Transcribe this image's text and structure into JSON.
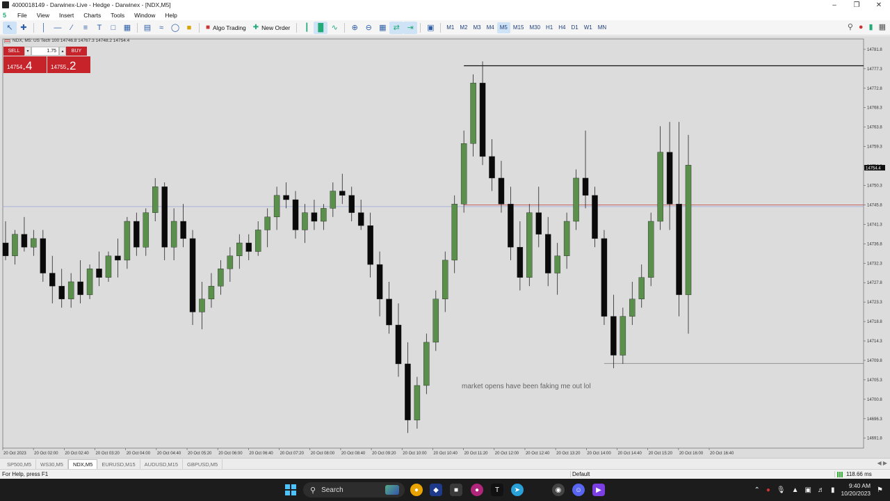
{
  "window": {
    "title": "4000018149 - Darwinex-Live - Hedge - Darwinex - [NDX,M5]"
  },
  "menu": [
    "File",
    "View",
    "Insert",
    "Charts",
    "Tools",
    "Window",
    "Help"
  ],
  "toolbar": {
    "algo_trading": "Algo Trading",
    "new_order": "New Order",
    "timeframes": [
      "M1",
      "M2",
      "M3",
      "M4",
      "M5",
      "M15",
      "M30",
      "H1",
      "H4",
      "D1",
      "W1",
      "MN"
    ],
    "active_timeframe": "M5"
  },
  "chart": {
    "symbol_line": "NDX, M5: US Tech 100  14746.8 14767.3 14748.2 14754.4",
    "trade_panel": {
      "sell_label": "SELL",
      "buy_label": "BUY",
      "lot": "1.75",
      "sell_price_small": "14754",
      "sell_price_big": ".4",
      "buy_price_small": "14755",
      "buy_price_big": ".2"
    },
    "annotation": "market opens have been faking me out lol",
    "current_price_label": "14754.4",
    "colors": {
      "bull": "#5b8f4c",
      "bear": "#0a0a0a",
      "bid_line": "#c0504d",
      "ask_line": "#9aa3d8",
      "background": "#dcdcdc"
    }
  },
  "chart_data": {
    "type": "candlestick",
    "x_tick_labels": [
      "20 Oct 2023",
      "20 Oct 02:00",
      "20 Oct 02:40",
      "20 Oct 03:20",
      "20 Oct 04:00",
      "20 Oct 04:40",
      "20 Oct 05:20",
      "20 Oct 06:00",
      "20 Oct 06:40",
      "20 Oct 07:20",
      "20 Oct 08:00",
      "20 Oct 08:40",
      "20 Oct 09:20",
      "20 Oct 10:00",
      "20 Oct 10:40",
      "20 Oct 11:20",
      "20 Oct 12:00",
      "20 Oct 12:40",
      "20 Oct 13:20",
      "20 Oct 14:00",
      "20 Oct 14:40",
      "20 Oct 15:20",
      "20 Oct 16:00",
      "20 Oct 16:40"
    ],
    "y_tick_labels": [
      "14781.8",
      "14777.3",
      "14772.8",
      "14768.3",
      "14763.8",
      "14759.3",
      "14754.8",
      "14750.3",
      "14745.8",
      "14741.3",
      "14736.8",
      "14732.3",
      "14727.8",
      "14723.3",
      "14718.8",
      "14714.3",
      "14709.8",
      "14705.3",
      "14700.8",
      "14696.3",
      "14691.8"
    ],
    "ylim": [
      14689.5,
      14784.2
    ],
    "bid": 14745.8,
    "ask": 14745.4,
    "last": 14754.4,
    "horizontal_levels": [
      14778.0,
      14709.1
    ],
    "candles_ohlc": [
      [
        14737,
        14742,
        14733,
        14734
      ],
      [
        14734,
        14740,
        14732,
        14739
      ],
      [
        14739,
        14743,
        14735,
        14736
      ],
      [
        14736,
        14740,
        14734,
        14738
      ],
      [
        14738,
        14740,
        14728,
        14730
      ],
      [
        14730,
        14734,
        14723,
        14727
      ],
      [
        14727,
        14731,
        14722,
        14724
      ],
      [
        14724,
        14730,
        14722,
        14728
      ],
      [
        14728,
        14733,
        14723,
        14725
      ],
      [
        14725,
        14732,
        14724,
        14731
      ],
      [
        14731,
        14735,
        14727,
        14729
      ],
      [
        14729,
        14735,
        14728,
        14734
      ],
      [
        14734,
        14738,
        14729,
        14733
      ],
      [
        14733,
        14743,
        14731,
        14742
      ],
      [
        14742,
        14744,
        14734,
        14736
      ],
      [
        14736,
        14745,
        14734,
        14744
      ],
      [
        14744,
        14752,
        14742,
        14750
      ],
      [
        14750,
        14751,
        14733,
        14736
      ],
      [
        14736,
        14745,
        14733,
        14742
      ],
      [
        14742,
        14746,
        14736,
        14738
      ],
      [
        14738,
        14740,
        14718,
        14721
      ],
      [
        14721,
        14728,
        14717,
        14724
      ],
      [
        14724,
        14730,
        14722,
        14727
      ],
      [
        14727,
        14733,
        14725,
        14731
      ],
      [
        14731,
        14736,
        14728,
        14734
      ],
      [
        14734,
        14739,
        14731,
        14737
      ],
      [
        14737,
        14739,
        14733,
        14735
      ],
      [
        14735,
        14742,
        14734,
        14740
      ],
      [
        14740,
        14745,
        14736,
        14743
      ],
      [
        14743,
        14750,
        14740,
        14748
      ],
      [
        14748,
        14751,
        14745,
        14747
      ],
      [
        14747,
        14749,
        14738,
        14740
      ],
      [
        14740,
        14746,
        14737,
        14744
      ],
      [
        14744,
        14747,
        14740,
        14742
      ],
      [
        14742,
        14746,
        14740,
        14745
      ],
      [
        14745,
        14751,
        14743,
        14749
      ],
      [
        14749,
        14753,
        14746,
        14748
      ],
      [
        14748,
        14750,
        14742,
        14744
      ],
      [
        14744,
        14747,
        14740,
        14741
      ],
      [
        14741,
        14744,
        14729,
        14732
      ],
      [
        14732,
        14735,
        14720,
        14724
      ],
      [
        14724,
        14728,
        14716,
        14718
      ],
      [
        14718,
        14723,
        14706,
        14709
      ],
      [
        14709,
        14714,
        14693,
        14696
      ],
      [
        14696,
        14706,
        14694,
        14704
      ],
      [
        14704,
        14716,
        14702,
        14714
      ],
      [
        14714,
        14726,
        14712,
        14724
      ],
      [
        14724,
        14735,
        14721,
        14733
      ],
      [
        14733,
        14748,
        14730,
        14746
      ],
      [
        14746,
        14763,
        14744,
        14760
      ],
      [
        14760,
        14776,
        14757,
        14774
      ],
      [
        14774,
        14779,
        14755,
        14757
      ],
      [
        14757,
        14761,
        14749,
        14752
      ],
      [
        14752,
        14756,
        14744,
        14746
      ],
      [
        14746,
        14750,
        14733,
        14736
      ],
      [
        14736,
        14742,
        14726,
        14729
      ],
      [
        14729,
        14746,
        14727,
        14744
      ],
      [
        14744,
        14750,
        14736,
        14739
      ],
      [
        14739,
        14743,
        14727,
        14730
      ],
      [
        14730,
        14737,
        14725,
        14734
      ],
      [
        14734,
        14744,
        14731,
        14742
      ],
      [
        14742,
        14754,
        14740,
        14752
      ],
      [
        14752,
        14763,
        14745,
        14748
      ],
      [
        14748,
        14750,
        14736,
        14738
      ],
      [
        14738,
        14740,
        14718,
        14720
      ],
      [
        14720,
        14725,
        14708,
        14711
      ],
      [
        14711,
        14722,
        14709,
        14720
      ],
      [
        14720,
        14728,
        14718,
        14724
      ],
      [
        14724,
        14732,
        14722,
        14729
      ],
      [
        14729,
        14744,
        14727,
        14742
      ],
      [
        14742,
        14764,
        14740,
        14758
      ],
      [
        14758,
        14765,
        14740,
        14746
      ],
      [
        14746,
        14765,
        14720,
        14725
      ],
      [
        14725,
        14762,
        14716,
        14755
      ]
    ]
  },
  "tabs": [
    "SP500,M5",
    "WS30,M5",
    "NDX,M5",
    "EURUSD,M15",
    "AUDUSD,M15",
    "GBPUSD,M5"
  ],
  "active_tab": "NDX,M5",
  "status": {
    "help": "For Help, press F1",
    "profile": "Default",
    "ping": "118.66 ms"
  },
  "taskbar": {
    "search": "Search",
    "time": "9:40 AM",
    "date": "10/20/2023"
  }
}
